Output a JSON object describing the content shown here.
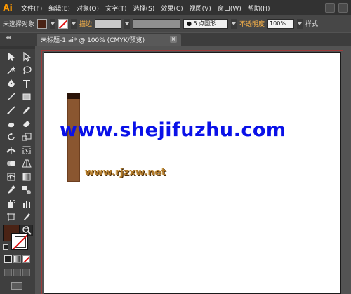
{
  "app": {
    "logo": "Ai"
  },
  "menu": [
    "文件(F)",
    "编辑(E)",
    "对象(O)",
    "文字(T)",
    "选择(S)",
    "效果(C)",
    "视图(V)",
    "窗口(W)",
    "帮助(H)"
  ],
  "control_bar": {
    "selection_label": "未选择对象",
    "stroke_label": "描边",
    "brush_label": "● 5 点圆形",
    "opacity_label": "不透明度",
    "opacity_value": "100%",
    "style_label": "样式"
  },
  "tab": {
    "collapse": "◂◂",
    "title": "未标题-1.ai* @ 100% (CMYK/预览)",
    "close": "×"
  },
  "tools": [
    "selection-tool",
    "direct-selection-tool",
    "magic-wand-tool",
    "lasso-tool",
    "pen-tool",
    "type-tool",
    "line-segment-tool",
    "rectangle-tool",
    "paintbrush-tool",
    "pencil-tool",
    "blob-brush-tool",
    "eraser-tool",
    "rotate-tool",
    "scale-tool",
    "width-tool",
    "free-transform-tool",
    "shape-builder-tool",
    "perspective-grid-tool",
    "mesh-tool",
    "gradient-tool",
    "eyedropper-tool",
    "blend-tool",
    "symbol-sprayer-tool",
    "column-graph-tool",
    "artboard-tool",
    "slice-tool",
    "hand-tool",
    "zoom-tool"
  ],
  "colors": {
    "fill": "#4a2315",
    "stroke": "none",
    "wood": "#8a5630",
    "watermark_main": "#0a11e8",
    "watermark_small": "#b27a2a",
    "accent": "#ffb64a"
  },
  "canvas": {
    "watermark_main": "www.shejifuzhu.com",
    "watermark_small": "www.rjzxw.net"
  }
}
